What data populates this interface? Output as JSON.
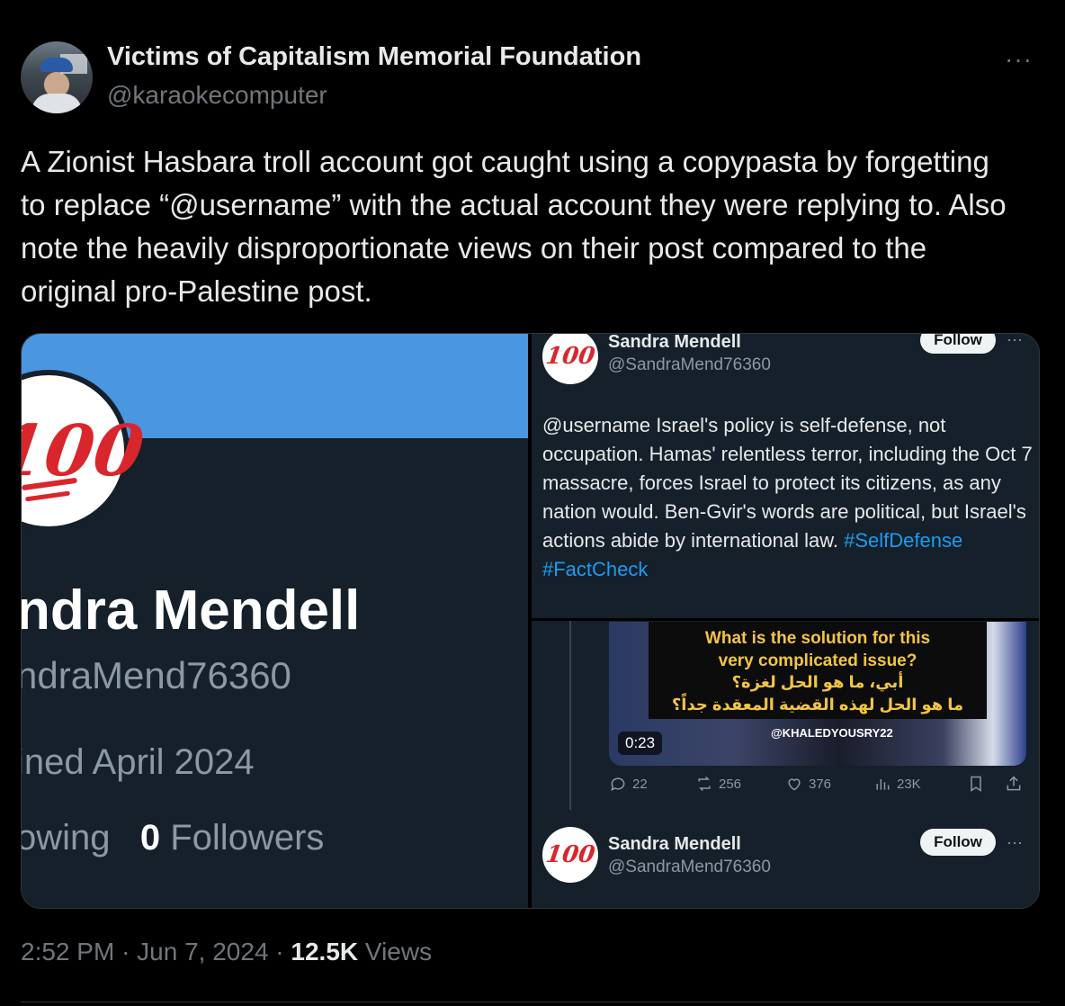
{
  "post": {
    "author_name": "Victims of Capitalism Memorial Foundation",
    "author_handle": "@karaokecomputer",
    "more": "···",
    "text": "A Zionist Hasbara troll account got caught using a copypasta by forgetting to replace “@username” with the actual account they were replying to. Also note the heavily disproportionate views on their post compared to the original pro-Palestine post.",
    "time": "2:52 PM",
    "date": "Jun 7, 2024",
    "sep": "·",
    "views_count": "12.5K",
    "views_label": "Views"
  },
  "left_panel": {
    "avatar_glyph": "100",
    "name": "ndra Mendell",
    "handle": "ndraMend76360",
    "joined": "ined April 2024",
    "following_label": "owing",
    "followers_count": "0",
    "followers_label": "Followers"
  },
  "right_panel": {
    "avatar_glyph": "100",
    "name": "Sandra Mendell",
    "handle": "@SandraMend76360",
    "follow_label": "Follow",
    "more": "···",
    "text_main": "@username Israel's policy is self-defense, not occupation. Hamas' relentless terror, including the Oct 7 massacre, forces Israel to protect its citizens, as any nation would. Ben-Gvir's words are political, but Israel's actions abide by international law.",
    "hashtags": "#SelfDefense #FactCheck",
    "video": {
      "caption_en_1": "What is the solution for this",
      "caption_en_2": "very complicated issue?",
      "caption_ar_1": "أبي، ما هو الحل لغزة؟",
      "caption_ar_2": "ما هو الحل لهذه القضية المعقدة جداً؟",
      "watermark": "@KHALEDYOUSRY22",
      "duration": "0:23"
    },
    "actions": {
      "replies": "22",
      "reposts": "256",
      "likes": "376",
      "views": "23K"
    },
    "reply": {
      "avatar_glyph": "100",
      "name": "Sandra Mendell",
      "handle": "@SandraMend76360",
      "follow_label": "Follow",
      "more": "···"
    }
  },
  "colors": {
    "background": "#000000",
    "card": "#15202b",
    "banner": "#4a96e0",
    "link": "#1d9bf0",
    "emoji_red": "#d9262c",
    "caption_yellow": "#f3c544"
  }
}
